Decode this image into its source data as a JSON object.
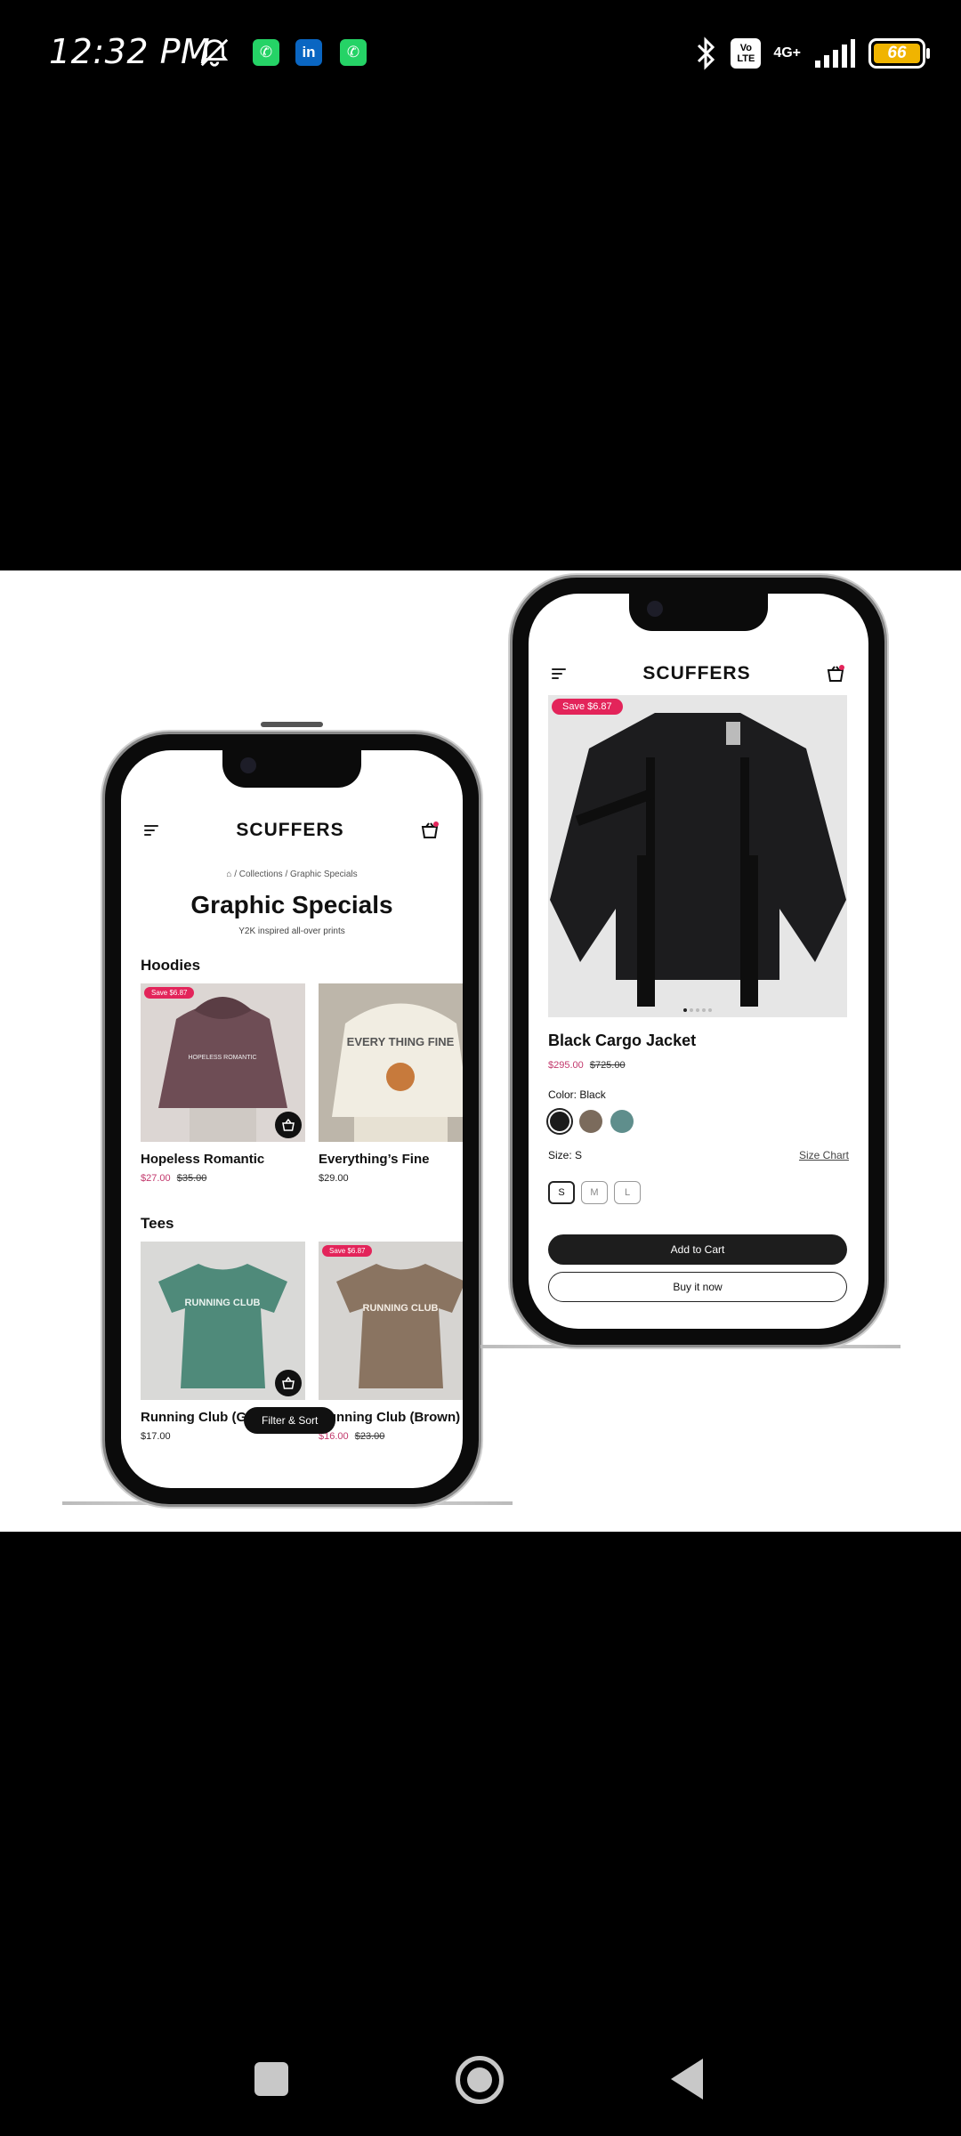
{
  "status_bar": {
    "time": "12:32 PM",
    "network": "4G+",
    "volte": "Vo LTE",
    "battery": "66",
    "apps": [
      {
        "name": "whatsapp-icon",
        "glyph": "✆",
        "color": "#25D366"
      },
      {
        "name": "linkedin-icon",
        "glyph": "in",
        "color": "#0A66C2"
      },
      {
        "name": "whatsapp-icon",
        "glyph": "✆",
        "color": "#25D366"
      }
    ]
  },
  "left_phone": {
    "brand": "SCUFFERS",
    "breadcrumb": {
      "sep": "/",
      "collections": "Collections",
      "current": "Graphic Specials"
    },
    "title": "Graphic Specials",
    "subtitle": "Y2K inspired all-over prints",
    "sections": [
      {
        "title": "Hoodies",
        "products": [
          {
            "name": "Hopeless Romantic",
            "badge": "Save $6.87",
            "price": "$27.00",
            "compare": "$35.00"
          },
          {
            "name": "Everything’s Fine",
            "price": "$29.00"
          }
        ]
      },
      {
        "title": "Tees",
        "products": [
          {
            "name": "Running Club (Green)",
            "price": "$17.00"
          },
          {
            "name": "Running Club (Brown)",
            "badge": "Save $6.87",
            "price": "$16.00",
            "compare": "$23.00"
          }
        ]
      }
    ],
    "filter_label": "Filter & Sort",
    "print_text": {
      "hoodie1": "HOPELESS ROMANTIC",
      "hoodie2": "EVERY THING FINE",
      "tee": "RUNNING CLUB"
    }
  },
  "right_phone": {
    "brand": "SCUFFERS",
    "badge": "Save $6.87",
    "title": "Black Cargo Jacket",
    "price": "$295.00",
    "compare": "$725.00",
    "color_label": "Color: Black",
    "colors": [
      "#1b1b1b",
      "#7b6b5c",
      "#5f8e8c"
    ],
    "size_label": "Size: S",
    "size_chart": "Size Chart",
    "sizes": [
      "S",
      "M",
      "L"
    ],
    "add_to_cart": "Add to Cart",
    "buy_now": "Buy it now"
  },
  "colors": {
    "accent_sale": "#c2386c",
    "badge": "#e3245a",
    "dark": "#111111"
  }
}
